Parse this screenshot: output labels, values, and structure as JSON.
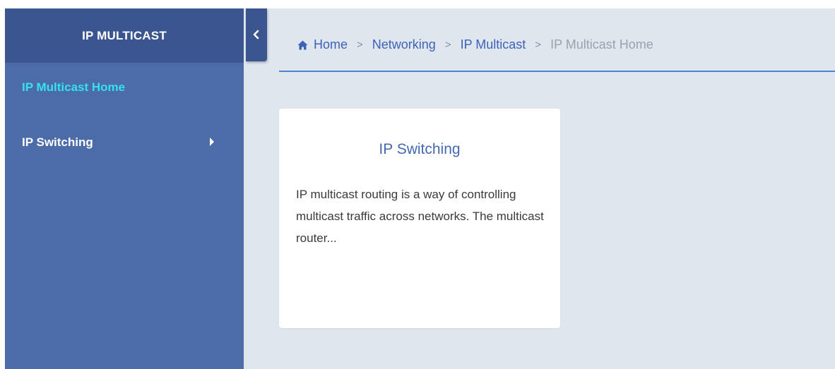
{
  "sidebar": {
    "title": "IP MULTICAST",
    "items": [
      {
        "label": "IP Multicast Home",
        "active": true
      },
      {
        "label": "IP Switching",
        "has_submenu": true
      }
    ]
  },
  "breadcrumb": {
    "home": "Home",
    "level1": "Networking",
    "level2": "IP Multicast",
    "current": "IP Multicast Home",
    "separator": ">"
  },
  "card": {
    "title": "IP Switching",
    "description": "IP multicast routing is a way of controlling multicast traffic across networks. The multicast router..."
  },
  "colors": {
    "sidebar": "#4c6ca9",
    "sidebar_header": "#3a5590",
    "active_item": "#36e0ec",
    "link": "#3d62b8",
    "content_bg": "#dfe6ee"
  }
}
